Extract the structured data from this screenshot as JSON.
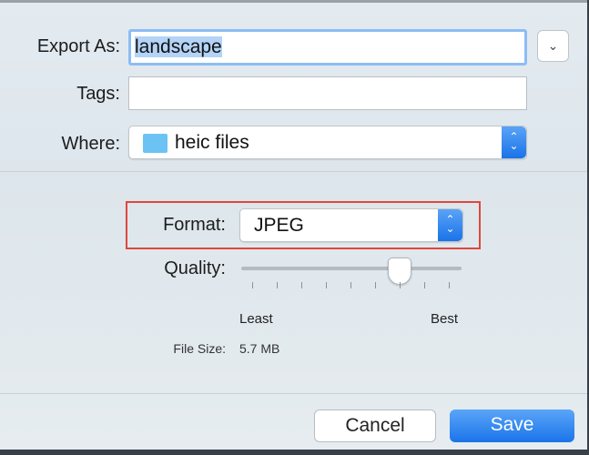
{
  "export_as": {
    "label": "Export As:",
    "value": "landscape"
  },
  "tags": {
    "label": "Tags:",
    "value": ""
  },
  "where": {
    "label": "Where:",
    "value": "heic files",
    "icon": "folder-icon"
  },
  "format": {
    "label": "Format:",
    "value": "JPEG",
    "highlight_color": "#e0463c"
  },
  "quality": {
    "label": "Quality:",
    "min_label": "Least",
    "max_label": "Best",
    "value_fraction": 0.75,
    "ticks": 9
  },
  "file_size": {
    "label": "File Size:",
    "value": "5.7 MB"
  },
  "buttons": {
    "cancel": "Cancel",
    "save": "Save"
  },
  "colors": {
    "accent": "#1a73e8",
    "selection": "#b3d3f7"
  }
}
